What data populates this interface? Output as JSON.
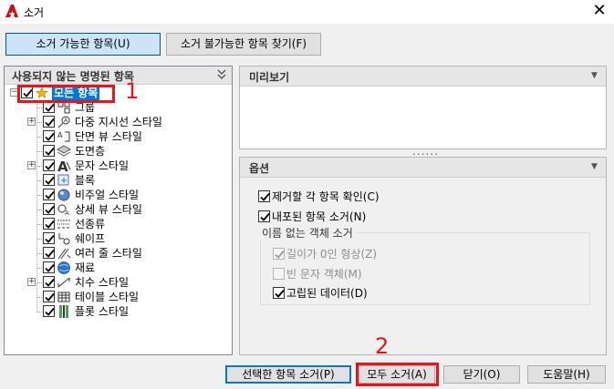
{
  "window": {
    "title": "소거",
    "close_glyph": "✕"
  },
  "tabs": {
    "purgeable": "소거 가능한 항목(U)",
    "find_nonpurgeable": "소거 불가능한 항목 찾기(F)"
  },
  "left_panel": {
    "header": "사용되지 않는 명명된 항목",
    "collapse_glyph": "❯❯",
    "root": {
      "label": "모든 항목",
      "checked": true,
      "selected": true,
      "icon": "star-folder-icon"
    },
    "items": [
      {
        "label": "그룹",
        "checked": true,
        "expandable": false,
        "icon": "group-icon"
      },
      {
        "label": "다중 지시선 스타일",
        "checked": true,
        "expandable": true,
        "icon": "multileader-icon"
      },
      {
        "label": "단면 뷰 스타일",
        "checked": true,
        "expandable": false,
        "icon": "section-view-icon"
      },
      {
        "label": "도면층",
        "checked": true,
        "expandable": false,
        "icon": "layers-icon"
      },
      {
        "label": "문자 스타일",
        "checked": true,
        "expandable": true,
        "icon": "text-style-icon"
      },
      {
        "label": "블록",
        "checked": true,
        "expandable": false,
        "icon": "block-icon"
      },
      {
        "label": "비주얼 스타일",
        "checked": true,
        "expandable": false,
        "icon": "visual-style-icon"
      },
      {
        "label": "상세 뷰 스타일",
        "checked": true,
        "expandable": false,
        "icon": "detail-view-icon"
      },
      {
        "label": "선종류",
        "checked": true,
        "expandable": false,
        "icon": "linetype-icon"
      },
      {
        "label": "쉐이프",
        "checked": true,
        "expandable": false,
        "icon": "shape-icon"
      },
      {
        "label": "여러 줄 스타일",
        "checked": true,
        "expandable": false,
        "icon": "multiline-icon"
      },
      {
        "label": "재료",
        "checked": true,
        "expandable": false,
        "icon": "material-globe-icon"
      },
      {
        "label": "치수 스타일",
        "checked": true,
        "expandable": true,
        "icon": "dimension-icon"
      },
      {
        "label": "테이블 스타일",
        "checked": true,
        "expandable": false,
        "icon": "table-icon"
      },
      {
        "label": "플롯 스타일",
        "checked": true,
        "expandable": false,
        "icon": "plot-style-icon"
      }
    ]
  },
  "preview": {
    "header": "미리보기",
    "arrow_glyph": "▼"
  },
  "options": {
    "header": "옵션",
    "arrow_glyph": "▼",
    "splitter_glyph": "......",
    "confirm_each": {
      "label": "제거할 각 항목 확인(C)",
      "checked": true
    },
    "purge_nested": {
      "label": "내포된 항목 소거(N)",
      "checked": true
    },
    "group_title": "이름 없는 객체 소거",
    "zero_length": {
      "label": "길이가 0인 형상(Z)",
      "checked": true,
      "disabled": true
    },
    "empty_text": {
      "label": "빈 문자 객체(M)",
      "checked": false,
      "disabled": true
    },
    "orphaned_data": {
      "label": "고립된 데이터(D)",
      "checked": true
    }
  },
  "buttons": {
    "purge_checked": "선택한 항목 소거(P)",
    "purge_all": "모두 소거(A)",
    "close": "닫기(O)",
    "help": "도움말(H)"
  },
  "annotations": {
    "step1": "1",
    "step2": "2",
    "color": "#e8141c"
  }
}
